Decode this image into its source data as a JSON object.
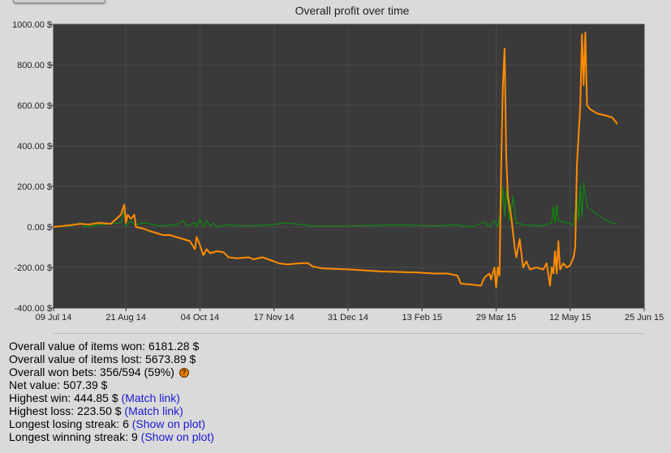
{
  "chart_data": {
    "type": "line",
    "title": "Overall profit over time",
    "xlabel": "",
    "ylabel": "",
    "y_ticks": [
      "1000.00 $",
      "800.00 $",
      "600.00 $",
      "400.00 $",
      "200.00 $",
      "0.00 $",
      "-200.00 $",
      "-400.00 $"
    ],
    "y_tick_values": [
      1000,
      800,
      600,
      400,
      200,
      0,
      -200,
      -400
    ],
    "x_ticks": [
      "09 Jul 14",
      "21 Aug 14",
      "04 Oct 14",
      "17 Nov 14",
      "31 Dec 14",
      "13 Feb 15",
      "29 Mar 15",
      "12 May 15",
      "25 Jun 15"
    ],
    "x_tick_values": [
      "2014-07-09",
      "2014-08-21",
      "2014-10-04",
      "2014-11-17",
      "2014-12-31",
      "2015-02-13",
      "2015-03-29",
      "2015-05-12",
      "2015-06-25"
    ],
    "xlim": [
      "2014-07-09",
      "2015-06-25"
    ],
    "ylim": [
      -400,
      1000
    ],
    "grid": true,
    "background": "#3a3a3a",
    "series": [
      {
        "color": "#ff8c00",
        "points": [
          [
            "2014-07-09",
            0
          ],
          [
            "2014-07-15",
            5
          ],
          [
            "2014-07-20",
            10
          ],
          [
            "2014-07-25",
            15
          ],
          [
            "2014-07-30",
            12
          ],
          [
            "2014-08-05",
            20
          ],
          [
            "2014-08-12",
            15
          ],
          [
            "2014-08-18",
            60
          ],
          [
            "2014-08-20",
            110
          ],
          [
            "2014-08-21",
            20
          ],
          [
            "2014-08-22",
            60
          ],
          [
            "2014-08-24",
            40
          ],
          [
            "2014-08-26",
            60
          ],
          [
            "2014-08-27",
            0
          ],
          [
            "2014-09-01",
            -10
          ],
          [
            "2014-09-04",
            -20
          ],
          [
            "2014-09-08",
            -30
          ],
          [
            "2014-09-12",
            -40
          ],
          [
            "2014-09-16",
            -40
          ],
          [
            "2014-09-20",
            -50
          ],
          [
            "2014-09-24",
            -60
          ],
          [
            "2014-09-28",
            -70
          ],
          [
            "2014-10-01",
            -110
          ],
          [
            "2014-10-02",
            -50
          ],
          [
            "2014-10-04",
            -90
          ],
          [
            "2014-10-06",
            -140
          ],
          [
            "2014-10-08",
            -110
          ],
          [
            "2014-10-10",
            -130
          ],
          [
            "2014-10-14",
            -120
          ],
          [
            "2014-10-18",
            -125
          ],
          [
            "2014-10-21",
            -150
          ],
          [
            "2014-10-26",
            -155
          ],
          [
            "2014-11-02",
            -150
          ],
          [
            "2014-11-05",
            -160
          ],
          [
            "2014-11-10",
            -150
          ],
          [
            "2014-11-17",
            -170
          ],
          [
            "2014-11-20",
            -180
          ],
          [
            "2014-11-25",
            -185
          ],
          [
            "2014-12-02",
            -180
          ],
          [
            "2014-12-07",
            -178
          ],
          [
            "2014-12-10",
            -195
          ],
          [
            "2014-12-16",
            -205
          ],
          [
            "2015-01-01",
            -210
          ],
          [
            "2015-01-20",
            -220
          ],
          [
            "2015-02-10",
            -225
          ],
          [
            "2015-02-20",
            -230
          ],
          [
            "2015-02-28",
            -230
          ],
          [
            "2015-03-06",
            -240
          ],
          [
            "2015-03-08",
            -280
          ],
          [
            "2015-03-15",
            -285
          ],
          [
            "2015-03-20",
            -290
          ],
          [
            "2015-03-22",
            -250
          ],
          [
            "2015-03-25",
            -230
          ],
          [
            "2015-03-26",
            -260
          ],
          [
            "2015-03-28",
            -200
          ],
          [
            "2015-03-29",
            -300
          ],
          [
            "2015-03-30",
            -200
          ],
          [
            "2015-03-31",
            -240
          ],
          [
            "2015-04-01",
            300
          ],
          [
            "2015-04-02",
            700
          ],
          [
            "2015-04-03",
            880
          ],
          [
            "2015-04-04",
            350
          ],
          [
            "2015-04-05",
            150
          ],
          [
            "2015-04-07",
            50
          ],
          [
            "2015-04-09",
            -100
          ],
          [
            "2015-04-10",
            -150
          ],
          [
            "2015-04-12",
            -60
          ],
          [
            "2015-04-14",
            -200
          ],
          [
            "2015-04-16",
            -170
          ],
          [
            "2015-04-18",
            -210
          ],
          [
            "2015-04-22",
            -200
          ],
          [
            "2015-04-26",
            -210
          ],
          [
            "2015-04-28",
            -180
          ],
          [
            "2015-04-30",
            -290
          ],
          [
            "2015-05-01",
            -200
          ],
          [
            "2015-05-02",
            -230
          ],
          [
            "2015-05-03",
            -120
          ],
          [
            "2015-05-04",
            -230
          ],
          [
            "2015-05-05",
            -70
          ],
          [
            "2015-05-06",
            -210
          ],
          [
            "2015-05-08",
            -180
          ],
          [
            "2015-05-10",
            -200
          ],
          [
            "2015-05-12",
            -190
          ],
          [
            "2015-05-14",
            -150
          ],
          [
            "2015-05-15",
            -100
          ],
          [
            "2015-05-16",
            300
          ],
          [
            "2015-05-17",
            450
          ],
          [
            "2015-05-18",
            600
          ],
          [
            "2015-05-19",
            950
          ],
          [
            "2015-05-20",
            700
          ],
          [
            "2015-05-21",
            960
          ],
          [
            "2015-05-22",
            600
          ],
          [
            "2015-05-24",
            580
          ],
          [
            "2015-05-28",
            560
          ],
          [
            "2015-06-02",
            550
          ],
          [
            "2015-06-06",
            540
          ],
          [
            "2015-06-08",
            520
          ],
          [
            "2015-06-09",
            507
          ]
        ]
      },
      {
        "color": "#0f8a0f",
        "points": [
          [
            "2014-07-09",
            0
          ],
          [
            "2014-07-20",
            5
          ],
          [
            "2014-07-25",
            20
          ],
          [
            "2014-07-28",
            0
          ],
          [
            "2014-08-05",
            10
          ],
          [
            "2014-08-18",
            20
          ],
          [
            "2014-08-20",
            80
          ],
          [
            "2014-08-21",
            0
          ],
          [
            "2014-08-24",
            30
          ],
          [
            "2014-08-26",
            10
          ],
          [
            "2014-09-01",
            20
          ],
          [
            "2014-09-10",
            5
          ],
          [
            "2014-09-20",
            10
          ],
          [
            "2014-09-24",
            30
          ],
          [
            "2014-09-26",
            5
          ],
          [
            "2014-10-01",
            20
          ],
          [
            "2014-10-02",
            0
          ],
          [
            "2014-10-04",
            40
          ],
          [
            "2014-10-06",
            0
          ],
          [
            "2014-10-08",
            30
          ],
          [
            "2014-10-10",
            5
          ],
          [
            "2014-10-12",
            20
          ],
          [
            "2014-10-14",
            0
          ],
          [
            "2014-10-20",
            10
          ],
          [
            "2014-11-01",
            5
          ],
          [
            "2014-11-15",
            10
          ],
          [
            "2014-11-24",
            20
          ],
          [
            "2014-12-10",
            5
          ],
          [
            "2015-01-01",
            5
          ],
          [
            "2015-02-01",
            10
          ],
          [
            "2015-02-20",
            5
          ],
          [
            "2015-03-05",
            10
          ],
          [
            "2015-03-15",
            0
          ],
          [
            "2015-03-22",
            25
          ],
          [
            "2015-03-25",
            0
          ],
          [
            "2015-03-28",
            30
          ],
          [
            "2015-03-30",
            0
          ],
          [
            "2015-04-01",
            100
          ],
          [
            "2015-04-02",
            200
          ],
          [
            "2015-04-03",
            50
          ],
          [
            "2015-04-04",
            180
          ],
          [
            "2015-04-06",
            30
          ],
          [
            "2015-04-08",
            150
          ],
          [
            "2015-04-10",
            20
          ],
          [
            "2015-04-15",
            10
          ],
          [
            "2015-04-25",
            5
          ],
          [
            "2015-05-01",
            20
          ],
          [
            "2015-05-02",
            100
          ],
          [
            "2015-05-03",
            20
          ],
          [
            "2015-05-04",
            110
          ],
          [
            "2015-05-05",
            30
          ],
          [
            "2015-05-10",
            20
          ],
          [
            "2015-05-14",
            10
          ],
          [
            "2015-05-16",
            150
          ],
          [
            "2015-05-17",
            30
          ],
          [
            "2015-05-18",
            200
          ],
          [
            "2015-05-19",
            50
          ],
          [
            "2015-05-20",
            220
          ],
          [
            "2015-05-22",
            100
          ],
          [
            "2015-05-25",
            80
          ],
          [
            "2015-05-30",
            50
          ],
          [
            "2015-06-05",
            20
          ],
          [
            "2015-06-09",
            15
          ]
        ]
      }
    ]
  },
  "stats": {
    "items_won": "Overall value of items won: 6181.28 $",
    "items_lost": "Overall value of items lost: 5673.89 $",
    "won_bets": "Overall won bets: 356/594 (59%)",
    "help_glyph": "?",
    "net_value": "Net value: 507.39 $",
    "highest_win": "Highest win: 444.85 $",
    "highest_win_link": "(Match link)",
    "highest_loss": "Highest loss: 223.50 $",
    "highest_loss_link": "(Match link)",
    "losing_streak": "Longest losing streak: 6",
    "losing_streak_link": "(Show on plot)",
    "winning_streak": "Longest winning streak: 9",
    "winning_streak_link": "(Show on plot)"
  }
}
